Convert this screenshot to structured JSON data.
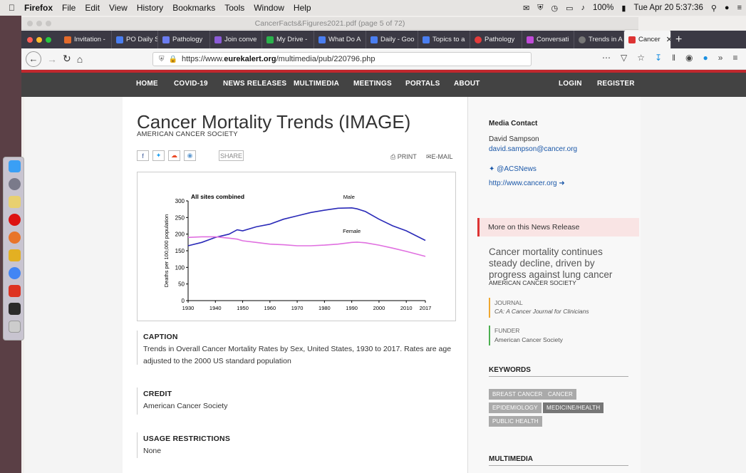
{
  "menubar": {
    "app": "Firefox",
    "items": [
      "File",
      "Edit",
      "View",
      "History",
      "Bookmarks",
      "Tools",
      "Window",
      "Help"
    ],
    "battery": "100%",
    "clock": "Tue Apr 20  5:37:36"
  },
  "window": {
    "doc_title": "CancerFacts&Figures2021.pdf (page 5 of 72)"
  },
  "tabs": [
    {
      "label": "Invitation -",
      "color": "#e36b2c"
    },
    {
      "label": "PO Daily S",
      "color": "#4a7ef0"
    },
    {
      "label": "Pathology",
      "color": "#6b7cf0"
    },
    {
      "label": "Join conve",
      "color": "#8c5cd8"
    },
    {
      "label": "My Drive -",
      "color": "#2bb24c"
    },
    {
      "label": "What Do A",
      "color": "#4a7ef0"
    },
    {
      "label": "Daily - Goo",
      "color": "#4a7ef0"
    },
    {
      "label": "Topics to a",
      "color": "#4a7ef0"
    },
    {
      "label": "Pathology",
      "color": "#e33b3b"
    },
    {
      "label": "Conversati",
      "color": "#c04bd8"
    },
    {
      "label": "Trends in A",
      "color": "#777"
    },
    {
      "label": "Cancer",
      "color": "#d33",
      "active": true
    }
  ],
  "nav": {
    "url_prefix": "https://www.",
    "url_domain": "eurekalert.org",
    "url_path": "/multimedia/pub/220796.php"
  },
  "site_nav": [
    "HOME",
    "COVID-19",
    "NEWS RELEASES",
    "MULTIMEDIA",
    "MEETINGS",
    "PORTALS",
    "ABOUT",
    "LOGIN",
    "REGISTER"
  ],
  "article": {
    "title": "Cancer Mortality Trends (IMAGE)",
    "org": "AMERICAN CANCER SOCIETY",
    "share_label": "SHARE",
    "print_label": "PRINT",
    "email_label": "E-MAIL",
    "caption_heading": "CAPTION",
    "caption_line1": "Trends in Overall Cancer Mortality Rates by Sex, United States, 1930 to 2017. Rates are age",
    "caption_line2": "adjusted to the 2000 US standard population",
    "credit_heading": "CREDIT",
    "credit_text": "American Cancer Society",
    "usage_heading": "USAGE RESTRICTIONS",
    "usage_text": "None"
  },
  "sidebar": {
    "media_contact_heading": "Media Contact",
    "contact_name": "David Sampson",
    "contact_email": "david.sampson@cancer.org",
    "twitter": "@ACSNews",
    "website": "http://www.cancer.org",
    "more_news": "More on this News Release",
    "news_title": "Cancer mortality continues steady decline, driven by progress against lung cancer",
    "news_org": "AMERICAN CANCER SOCIETY",
    "journal_label": "JOURNAL",
    "journal_name": "CA: A Cancer Journal for Clinicians",
    "funder_label": "FUNDER",
    "funder_name": "American Cancer Society",
    "keywords_heading": "KEYWORDS",
    "keywords": [
      "BREAST CANCER",
      "CANCER",
      "EPIDEMIOLOGY",
      "MEDICINE/HEALTH",
      "PUBLIC HEALTH"
    ],
    "multimedia_heading": "MULTIMEDIA"
  },
  "chart_data": {
    "type": "line",
    "title": "All sites combined",
    "ylabel": "Deaths per 100,000 population",
    "xlabel": "",
    "xlim": [
      1930,
      2017
    ],
    "ylim": [
      0,
      300
    ],
    "x_ticks": [
      "1930",
      "1940",
      "1950",
      "1960",
      "1970",
      "1980",
      "1990",
      "2000",
      "2010",
      "2017"
    ],
    "y_ticks": [
      "0",
      "50",
      "100",
      "150",
      "200",
      "250",
      "300"
    ],
    "series": [
      {
        "name": "Male",
        "color": "#2a2ab8",
        "x": [
          1930,
          1935,
          1940,
          1945,
          1948,
          1950,
          1955,
          1960,
          1965,
          1970,
          1975,
          1980,
          1985,
          1990,
          1992,
          1995,
          2000,
          2005,
          2010,
          2017
        ],
        "y": [
          165,
          175,
          190,
          200,
          213,
          210,
          222,
          230,
          245,
          255,
          265,
          272,
          278,
          279,
          276,
          268,
          245,
          225,
          210,
          181
        ]
      },
      {
        "name": "Female",
        "color": "#e070e0",
        "x": [
          1930,
          1935,
          1940,
          1945,
          1948,
          1950,
          1955,
          1960,
          1965,
          1970,
          1975,
          1980,
          1985,
          1990,
          1992,
          1995,
          2000,
          2005,
          2010,
          2017
        ],
        "y": [
          190,
          192,
          192,
          188,
          185,
          180,
          175,
          170,
          168,
          165,
          165,
          167,
          170,
          175,
          176,
          174,
          167,
          158,
          148,
          133
        ]
      }
    ]
  }
}
